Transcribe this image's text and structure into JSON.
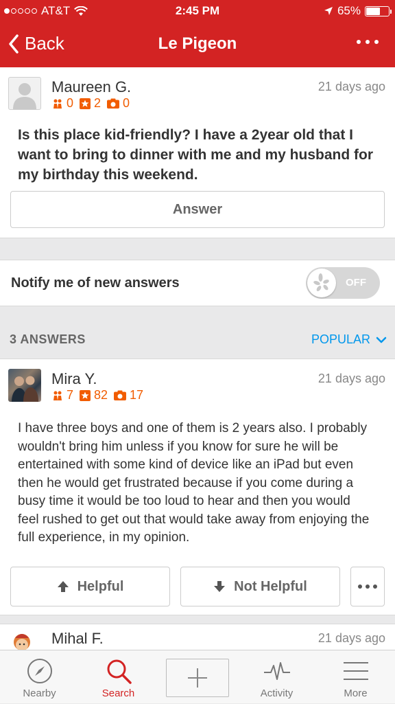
{
  "status_bar": {
    "carrier": "AT&T",
    "time": "2:45 PM",
    "battery": "65%",
    "battery_level": 0.65
  },
  "nav": {
    "back_label": "Back",
    "title": "Le Pigeon"
  },
  "question": {
    "user": "Maureen G.",
    "friends": "0",
    "reviews": "2",
    "photos": "0",
    "date": "21 days ago",
    "text": "Is this place kid-friendly? I have a 2year old that I want to bring to dinner with me and my husband for my birthday this weekend.",
    "answer_button": "Answer"
  },
  "notify": {
    "label": "Notify me of new answers",
    "toggle_state": "OFF"
  },
  "answers": {
    "count_label": "3 ANSWERS",
    "sort_label": "POPULAR"
  },
  "answer1": {
    "user": "Mira Y.",
    "friends": "7",
    "reviews": "82",
    "photos": "17",
    "date": "21 days ago",
    "text": "I have three boys and one of them is 2 years also. I probably wouldn't bring him unless if you know for sure he will be entertained with some kind of device like an iPad but even then he would get frustrated because if you come during a busy time it would be too loud to hear and then you would feel rushed to get out that would take away from enjoying the full experience, in my opinion.",
    "helpful_label": "Helpful",
    "not_helpful_label": "Not Helpful"
  },
  "answer2": {
    "user": "Mihal F.",
    "date": "21 days ago"
  },
  "tabs": [
    {
      "label": "Nearby",
      "icon": "compass-icon"
    },
    {
      "label": "Search",
      "icon": "search-icon"
    },
    {
      "label": "",
      "icon": "plus-icon"
    },
    {
      "label": "Activity",
      "icon": "activity-icon"
    },
    {
      "label": "More",
      "icon": "menu-icon"
    }
  ],
  "colors": {
    "brand_red": "#d32323",
    "stat_orange": "#f15c00",
    "link_blue": "#0097ec"
  }
}
